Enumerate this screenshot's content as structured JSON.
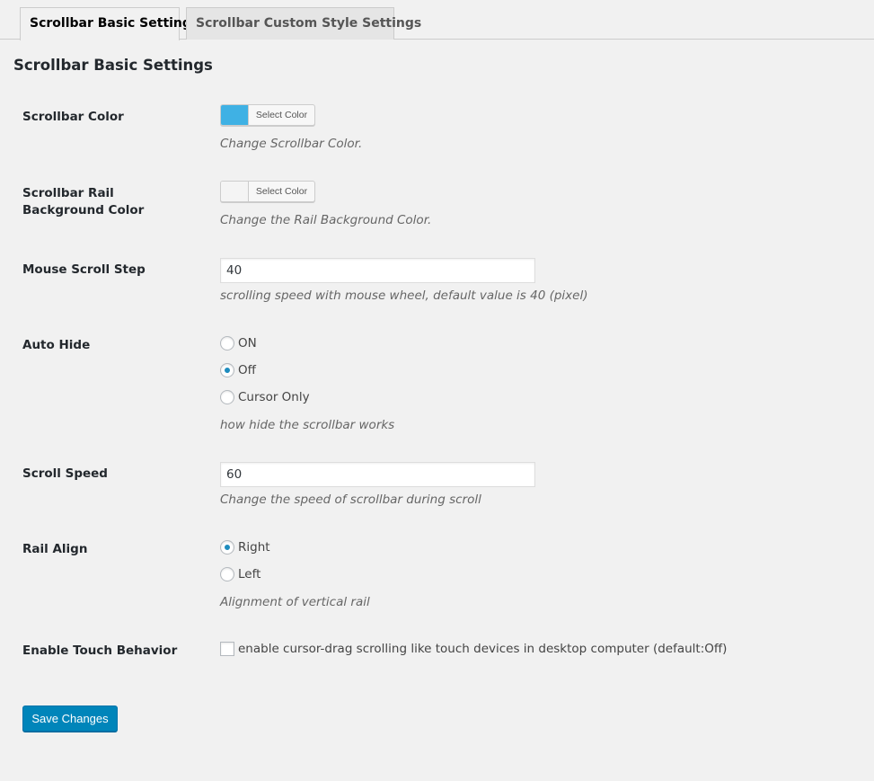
{
  "tabs": [
    {
      "label": "Scrollbar Basic Settings"
    },
    {
      "label": "Scrollbar Custom Style Settings"
    }
  ],
  "section_title": "Scrollbar Basic Settings",
  "fields": {
    "scrollbar_color": {
      "label": "Scrollbar Color",
      "button_label": "Select Color",
      "color": "#3fb1e4",
      "description": "Change Scrollbar Color."
    },
    "rail_bg_color": {
      "label": "Scrollbar Rail Background Color",
      "button_label": "Select Color",
      "color": "#f4f4f4",
      "description": "Change the Rail Background Color."
    },
    "mouse_scroll_step": {
      "label": "Mouse Scroll Step",
      "value": "40",
      "description": "scrolling speed with mouse wheel, default value is 40 (pixel)"
    },
    "auto_hide": {
      "label": "Auto Hide",
      "options": [
        "ON",
        "Off",
        "Cursor Only"
      ],
      "selected": "Off",
      "description": "how hide the scrollbar works"
    },
    "scroll_speed": {
      "label": "Scroll Speed",
      "value": "60",
      "description": "Change the speed of scrollbar during scroll"
    },
    "rail_align": {
      "label": "Rail Align",
      "options": [
        "Right",
        "Left"
      ],
      "selected": "Right",
      "description": "Alignment of vertical rail"
    },
    "touch_behavior": {
      "label": "Enable Touch Behavior",
      "checkbox_label": "enable cursor-drag scrolling like touch devices in desktop computer (default:Off)",
      "checked": false
    }
  },
  "save_button": "Save Changes",
  "colors": {
    "accent": "#0085ba",
    "radio_dot": "#1e8cbe"
  }
}
